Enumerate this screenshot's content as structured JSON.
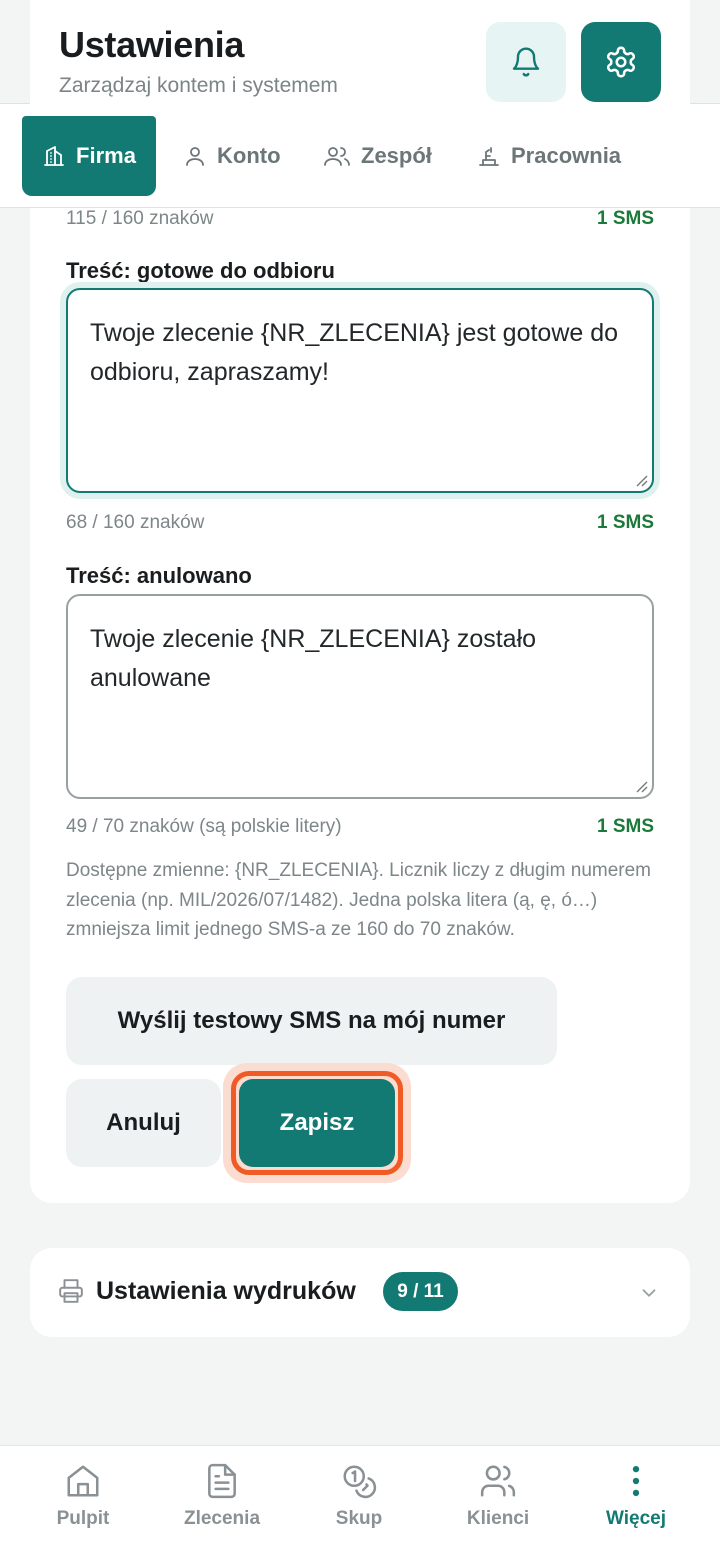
{
  "header": {
    "title": "Ustawienia",
    "subtitle": "Zarządzaj kontem i systemem",
    "bell_icon": "bell-icon",
    "gear_icon": "gear-icon"
  },
  "tabs": [
    {
      "label": "Firma",
      "icon": "building-icon",
      "active": true
    },
    {
      "label": "Konto",
      "icon": "user-icon",
      "active": false
    },
    {
      "label": "Zespół",
      "icon": "users-icon",
      "active": false
    },
    {
      "label": "Pracownia",
      "icon": "workbench-icon",
      "active": false
    }
  ],
  "sms_form": {
    "prev_counter": "115 / 160 znaków",
    "prev_sms": "1 SMS",
    "ready": {
      "label": "Treść: gotowe do odbioru",
      "value": "Twoje zlecenie {NR_ZLECENIA} jest gotowe do odbioru, zapraszamy!",
      "counter": "68 / 160 znaków",
      "sms": "1 SMS"
    },
    "cancelled": {
      "label": "Treść: anulowano",
      "value": "Twoje zlecenie {NR_ZLECENIA} zostało anulowane",
      "counter": "49 / 70 znaków (są polskie litery)",
      "sms": "1 SMS"
    },
    "help": "Dostępne zmienne: {NR_ZLECENIA}. Licznik liczy z długim numerem zlecenia (np. MIL/2026/07/1482). Jedna polska litera (ą, ę, ó…) zmniejsza limit jednego SMS-a ze 160 do 70 znaków.",
    "test_button": "Wyślij testowy SMS na mój numer",
    "cancel_button": "Anuluj",
    "save_button": "Zapisz"
  },
  "print_settings": {
    "title": "Ustawienia wydruków",
    "badge": "9 / 11"
  },
  "bottom_nav": [
    {
      "label": "Pulpit",
      "icon": "home-icon"
    },
    {
      "label": "Zlecenia",
      "icon": "document-icon"
    },
    {
      "label": "Skup",
      "icon": "coins-icon"
    },
    {
      "label": "Klienci",
      "icon": "clients-icon"
    },
    {
      "label": "Więcej",
      "icon": "more-icon",
      "active": true
    }
  ],
  "colors": {
    "accent": "#137a73",
    "highlight": "#f05a24",
    "sms_green": "#1b7a3a"
  }
}
